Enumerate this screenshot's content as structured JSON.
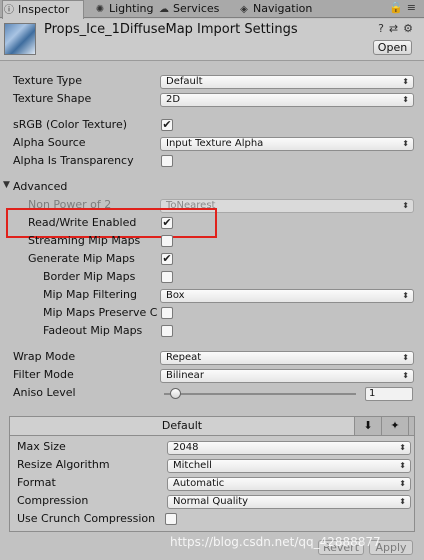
{
  "tabs": [
    {
      "label": "Inspector",
      "icon": "info-icon"
    },
    {
      "label": "Lighting",
      "icon": "bulb-icon"
    },
    {
      "label": "Services",
      "icon": "cloud-icon"
    },
    {
      "label": "Navigation",
      "icon": "compass-icon"
    }
  ],
  "header": {
    "title": "Props_Ice_1DiffuseMap Import Settings",
    "open_label": "Open"
  },
  "fields": {
    "texture_type": {
      "label": "Texture Type",
      "value": "Default"
    },
    "texture_shape": {
      "label": "Texture Shape",
      "value": "2D"
    },
    "srgb": {
      "label": "sRGB (Color Texture)",
      "checked": true
    },
    "alpha_source": {
      "label": "Alpha Source",
      "value": "Input Texture Alpha"
    },
    "alpha_is_transparency": {
      "label": "Alpha Is Transparency",
      "checked": false
    },
    "advanced": {
      "label": "Advanced"
    },
    "non_power_of_2": {
      "label": "Non Power of 2",
      "value": "ToNearest"
    },
    "read_write_enabled": {
      "label": "Read/Write Enabled",
      "checked": true
    },
    "streaming_mip_maps": {
      "label": "Streaming Mip Maps",
      "checked": false
    },
    "generate_mip_maps": {
      "label": "Generate Mip Maps",
      "checked": true
    },
    "border_mip_maps": {
      "label": "Border Mip Maps",
      "checked": false
    },
    "mip_map_filtering": {
      "label": "Mip Map Filtering",
      "value": "Box"
    },
    "mip_maps_preserve": {
      "label": "Mip Maps Preserve C",
      "checked": false
    },
    "fadeout_mip_maps": {
      "label": "Fadeout Mip Maps",
      "checked": false
    },
    "wrap_mode": {
      "label": "Wrap Mode",
      "value": "Repeat"
    },
    "filter_mode": {
      "label": "Filter Mode",
      "value": "Bilinear"
    },
    "aniso_level": {
      "label": "Aniso Level",
      "value": "1",
      "level": 1
    }
  },
  "platform": {
    "default_tab": "Default",
    "max_size": {
      "label": "Max Size",
      "value": "2048"
    },
    "resize_algorithm": {
      "label": "Resize Algorithm",
      "value": "Mitchell"
    },
    "format": {
      "label": "Format",
      "value": "Automatic"
    },
    "compression": {
      "label": "Compression",
      "value": "Normal Quality"
    },
    "use_crunch": {
      "label": "Use Crunch Compression",
      "checked": false
    }
  },
  "footer": {
    "revert_label": "Revert",
    "apply_label": "Apply"
  },
  "watermark": "https://blog.csdn.net/qq_42888877",
  "colors": {
    "highlight": "#e0211b",
    "background": "#c2c2c2"
  }
}
